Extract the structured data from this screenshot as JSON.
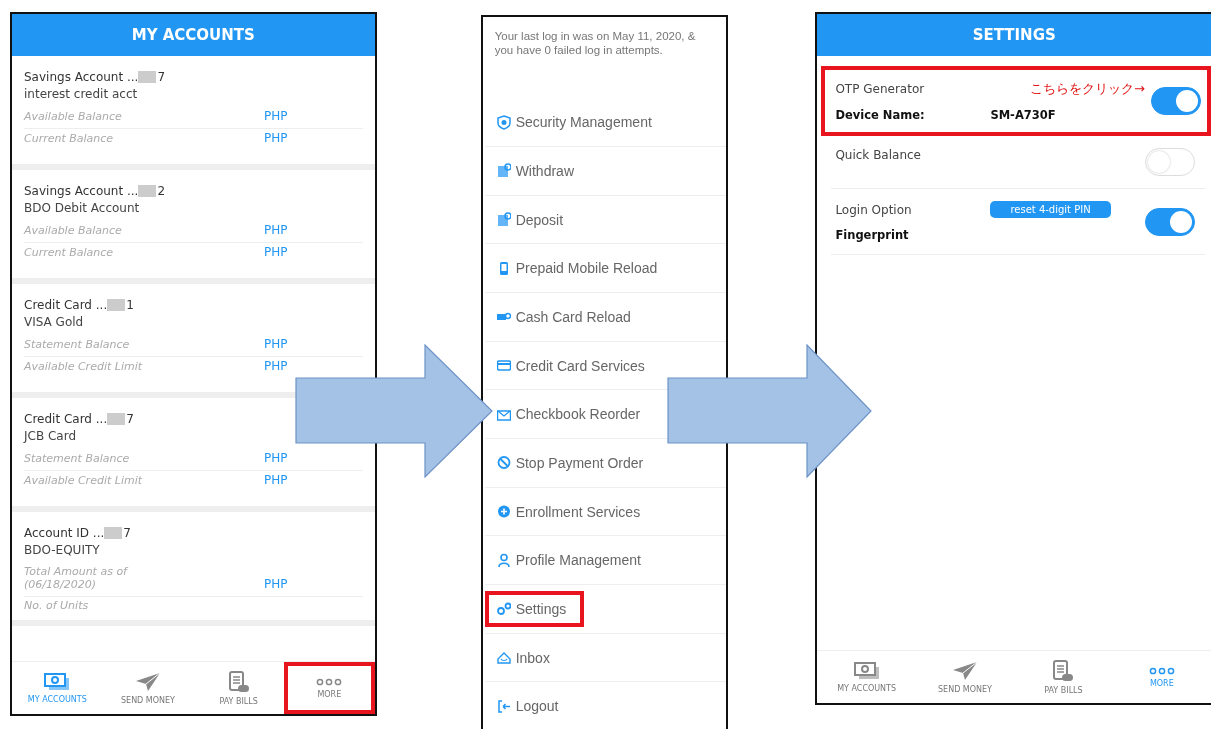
{
  "accounts_screen": {
    "title": "MY ACCOUNTS",
    "accounts": [
      {
        "name": "Savings Account ...",
        "suffix": "7",
        "description": "interest credit acct",
        "rows": [
          {
            "label": "Available Balance",
            "value": "PHP"
          },
          {
            "label": "Current Balance",
            "value": "PHP"
          }
        ]
      },
      {
        "name": "Savings Account ...",
        "suffix": "2",
        "description": "BDO Debit Account",
        "rows": [
          {
            "label": "Available Balance",
            "value": "PHP"
          },
          {
            "label": "Current Balance",
            "value": "PHP"
          }
        ]
      },
      {
        "name": "Credit Card ...",
        "suffix": "1",
        "description": "VISA Gold",
        "rows": [
          {
            "label": "Statement Balance",
            "value": "PHP"
          },
          {
            "label": "Available Credit Limit",
            "value": "PHP"
          }
        ]
      },
      {
        "name": "Credit Card ...",
        "suffix": "7",
        "description": "JCB Card",
        "rows": [
          {
            "label": "Statement Balance",
            "value": "PHP"
          },
          {
            "label": "Available Credit Limit",
            "value": "PHP"
          }
        ]
      },
      {
        "name": "Account ID ...",
        "suffix": "7",
        "description": "BDO-EQUITY",
        "rows": [
          {
            "label": "Total Amount as of (06/18/2020)",
            "value": "PHP"
          },
          {
            "label": "No. of Units"
          }
        ]
      }
    ],
    "nav": [
      {
        "label": "MY ACCOUNTS",
        "selected": true,
        "highlighted": false
      },
      {
        "label": "SEND MONEY",
        "selected": false,
        "highlighted": false
      },
      {
        "label": "PAY BILLS",
        "selected": false,
        "highlighted": false
      },
      {
        "label": "MORE",
        "selected": false,
        "highlighted": true
      }
    ]
  },
  "more_screen": {
    "notice": "Your last log in was on May 11, 2020, & you have 0 failed log in attempts.",
    "items": [
      {
        "label": "Security Management",
        "highlighted": false
      },
      {
        "label": "Withdraw",
        "highlighted": false
      },
      {
        "label": "Deposit",
        "highlighted": false
      },
      {
        "label": "Prepaid Mobile Reload",
        "highlighted": false
      },
      {
        "label": "Cash Card Reload",
        "highlighted": false
      },
      {
        "label": "Credit Card Services",
        "highlighted": false
      },
      {
        "label": "Checkbook Reorder",
        "highlighted": false
      },
      {
        "label": "Stop Payment Order",
        "highlighted": false
      },
      {
        "label": "Enrollment Services",
        "highlighted": false
      },
      {
        "label": "Profile Management",
        "highlighted": false
      },
      {
        "label": "Settings",
        "highlighted": true
      },
      {
        "label": "Inbox",
        "highlighted": false
      },
      {
        "label": "Logout",
        "highlighted": false
      }
    ]
  },
  "settings_screen": {
    "title": "SETTINGS",
    "settings": [
      {
        "label": "OTP Generator",
        "on": true,
        "highlighted": true,
        "note": "こちらをクリック→",
        "detail_label": "Device Name:",
        "detail_value": "SM-A730F"
      },
      {
        "label": "Quick Balance",
        "on": false,
        "highlighted": false
      },
      {
        "label": "Login Option",
        "on": true,
        "highlighted": false,
        "action": "reset 4-digit PIN",
        "detail_label": "Fingerprint"
      }
    ],
    "nav": [
      {
        "label": "MY ACCOUNTS",
        "selected": false,
        "highlighted": false
      },
      {
        "label": "SEND MONEY",
        "selected": false,
        "highlighted": false
      },
      {
        "label": "PAY BILLS",
        "selected": false,
        "highlighted": false
      },
      {
        "label": "MORE",
        "selected": true,
        "highlighted": false
      }
    ]
  }
}
